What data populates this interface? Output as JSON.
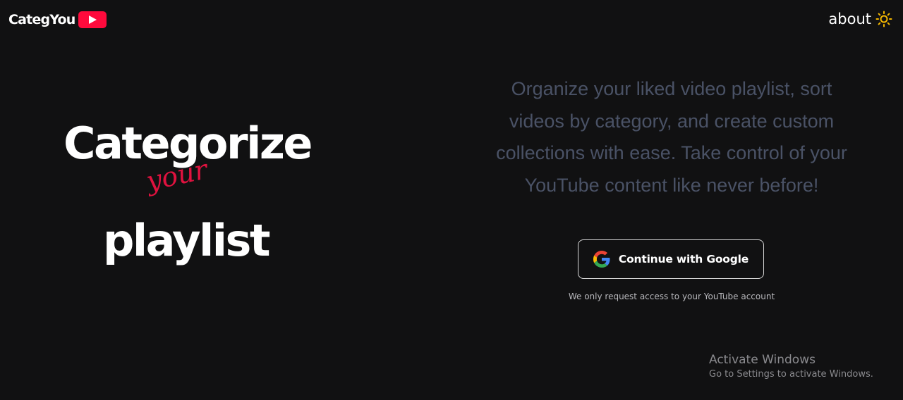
{
  "header": {
    "logo_text": "CategYou",
    "about_label": "about",
    "logo_icon": "youtube-play-icon",
    "theme_icon": "sun-icon"
  },
  "hero": {
    "line1": "Categorize",
    "line2": "your",
    "line3": "playlist"
  },
  "main": {
    "tagline": "Organize your liked video playlist, sort videos by category, and create custom collections with ease. Take control of your YouTube content like never before!",
    "google_button_label": "Continue with Google",
    "google_icon": "google-g-icon",
    "access_note": "We only request access to your YouTube account"
  },
  "watermark": {
    "title": "Activate Windows",
    "subtitle": "Go to Settings to activate Windows."
  },
  "colors": {
    "background": "#111112",
    "accent_red": "#e0123f",
    "tagline_gray": "#4a5266",
    "sun_yellow": "#f5b800"
  }
}
